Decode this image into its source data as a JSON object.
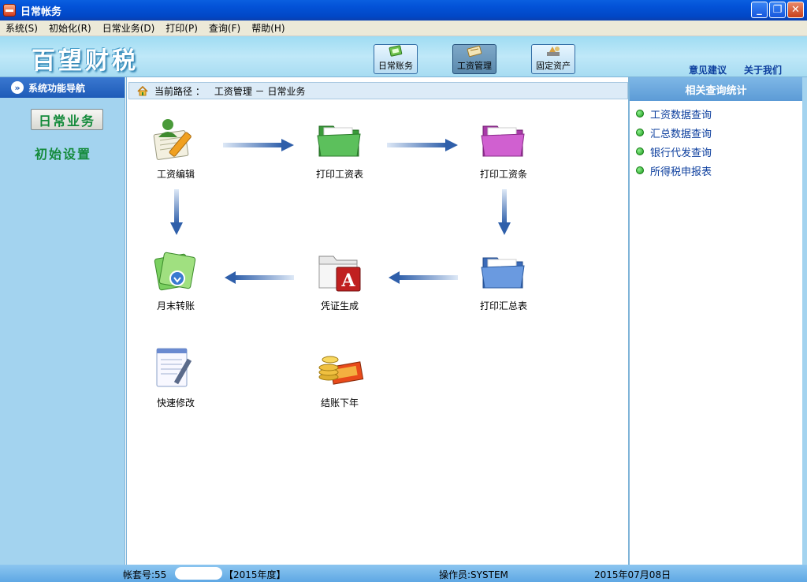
{
  "window": {
    "title": "日常帐务"
  },
  "menu": [
    "系统(S)",
    "初始化(R)",
    "日常业务(D)",
    "打印(P)",
    "查询(F)",
    "帮助(H)"
  ],
  "header": {
    "logo": "百望财税",
    "tabs": [
      {
        "label": "日常账务",
        "icon": "ledger-icon",
        "active": false
      },
      {
        "label": "工资管理",
        "icon": "salary-icon",
        "active": true
      },
      {
        "label": "固定资产",
        "icon": "asset-icon",
        "active": false
      }
    ],
    "links": [
      "意见建议",
      "关于我们"
    ]
  },
  "leftnav": {
    "title": "系统功能导航",
    "buttons": [
      "日常业务"
    ],
    "links": [
      "初始设置"
    ]
  },
  "path": {
    "label": "当前路径 ：",
    "value": "工资管理 － 日常业务"
  },
  "flow": {
    "items": [
      {
        "label": "工资编辑",
        "icon": "salary-edit-icon"
      },
      {
        "label": "打印工资表",
        "icon": "green-folder-icon"
      },
      {
        "label": "打印工资条",
        "icon": "pink-folder-icon"
      },
      {
        "label": "月末转账",
        "icon": "month-transfer-icon"
      },
      {
        "label": "凭证生成",
        "icon": "voucher-icon"
      },
      {
        "label": "打印汇总表",
        "icon": "blue-folder-icon"
      },
      {
        "label": "快速修改",
        "icon": "quick-edit-icon"
      },
      {
        "label": "结账下年",
        "icon": "coins-icon"
      }
    ]
  },
  "rightpanel": {
    "title": "相关查询统计",
    "items": [
      "工资数据查询",
      "汇总数据查询",
      "银行代发查询",
      "所得税申报表"
    ]
  },
  "status": {
    "account_label": "帐套号:55",
    "year": "【2015年度】",
    "operator": "操作员:SYSTEM",
    "date": "2015年07月08日"
  },
  "colors": {
    "titlebar": "#0353d8",
    "header": "#bfe8f8",
    "nav": "#a3d3ef",
    "link": "#0d3f9e",
    "nav_green": "#138a3a"
  }
}
